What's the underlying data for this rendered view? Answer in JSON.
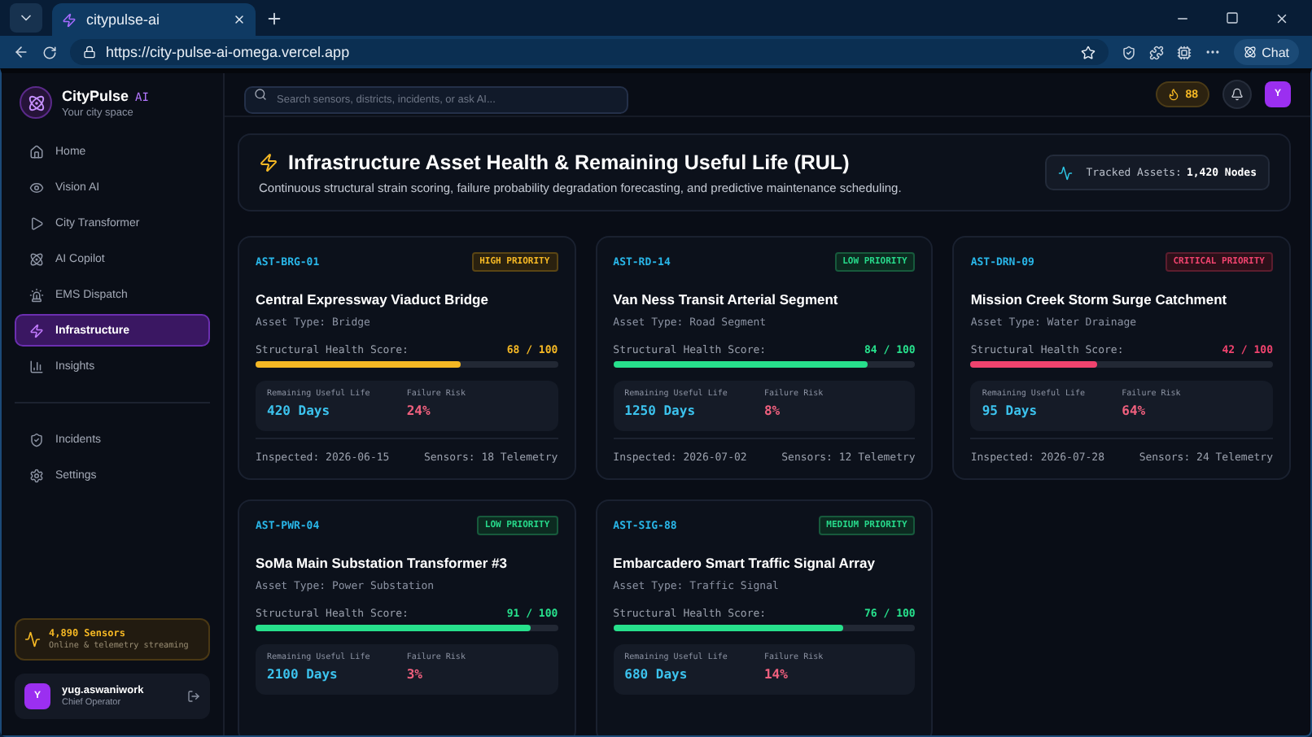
{
  "browser": {
    "tab_title": "citypulse-ai",
    "url": "https://city-pulse-ai-omega.vercel.app",
    "chat_label": "Chat"
  },
  "brand": {
    "name": "CityPulse",
    "badge": "AI",
    "tagline": "Your city space"
  },
  "nav": [
    {
      "label": "Home",
      "selected": false
    },
    {
      "label": "Vision AI",
      "selected": false
    },
    {
      "label": "City Transformer",
      "selected": false
    },
    {
      "label": "AI Copilot",
      "selected": false
    },
    {
      "label": "EMS Dispatch",
      "selected": false
    },
    {
      "label": "Infrastructure",
      "selected": true
    },
    {
      "label": "Insights",
      "selected": false
    }
  ],
  "nav_secondary": [
    {
      "label": "Incidents",
      "selected": false
    },
    {
      "label": "Settings",
      "selected": false
    }
  ],
  "sensors": {
    "count": "4,890 Sensors",
    "status": "Online & telemetry streaming"
  },
  "user": {
    "initial": "Y",
    "name": "yug.aswaniwork",
    "role": "Chief Operator"
  },
  "topbar": {
    "search_placeholder": "Search sensors, districts, incidents, or ask AI...",
    "streak": "88",
    "avatar": "Y"
  },
  "header": {
    "title": "Infrastructure Asset Health & Remaining Useful Life (RUL)",
    "subtitle": "Continuous structural strain scoring, failure probability degradation forecasting, and predictive maintenance scheduling.",
    "tracked_label": "Tracked Assets:",
    "tracked_value": "1,420 Nodes"
  },
  "assets": [
    {
      "id": "AST-BRG-01",
      "badge": {
        "kind": "high",
        "label": "HIGH PRIORITY"
      },
      "name": "Central Expressway Viaduct Bridge",
      "type": "Asset Type: Bridge",
      "score_label": "Structural Health Score:",
      "score": {
        "kind": "fair",
        "value": "68 / 100",
        "level": 0.68
      },
      "rul_label": "Remaining Useful Life",
      "rul": "420 Days",
      "risk_label": "Failure Risk",
      "risk": "24%",
      "inspected": "Inspected: 2026-06-15",
      "sensors": "Sensors: 18 Telemetry"
    },
    {
      "id": "AST-RD-14",
      "badge": {
        "kind": "low",
        "label": "LOW PRIORITY"
      },
      "name": "Van Ness Transit Arterial Segment",
      "type": "Asset Type: Road Segment",
      "score_label": "Structural Health Score:",
      "score": {
        "kind": "good",
        "value": "84 / 100",
        "level": 0.84
      },
      "rul_label": "Remaining Useful Life",
      "rul": "1250 Days",
      "risk_label": "Failure Risk",
      "risk": "8%",
      "inspected": "Inspected: 2026-07-02",
      "sensors": "Sensors: 12 Telemetry"
    },
    {
      "id": "AST-DRN-09",
      "badge": {
        "kind": "critical",
        "label": "CRITICAL PRIORITY"
      },
      "name": "Mission Creek Storm Surge Catchment",
      "type": "Asset Type: Water Drainage",
      "score_label": "Structural Health Score:",
      "score": {
        "kind": "poor",
        "value": "42 / 100",
        "level": 0.42
      },
      "rul_label": "Remaining Useful Life",
      "rul": "95 Days",
      "risk_label": "Failure Risk",
      "risk": "64%",
      "inspected": "Inspected: 2026-07-28",
      "sensors": "Sensors: 24 Telemetry"
    },
    {
      "id": "AST-PWR-04",
      "badge": {
        "kind": "low",
        "label": "LOW PRIORITY"
      },
      "name": "SoMa Main Substation Transformer #3",
      "type": "Asset Type: Power Substation",
      "score_label": "Structural Health Score:",
      "score": {
        "kind": "good",
        "value": "91 / 100",
        "level": 0.91
      },
      "rul_label": "Remaining Useful Life",
      "rul": "2100 Days",
      "risk_label": "Failure Risk",
      "risk": "3%"
    },
    {
      "id": "AST-SIG-88",
      "badge": {
        "kind": "medium",
        "label": "MEDIUM PRIORITY"
      },
      "name": "Embarcadero Smart Traffic Signal Array",
      "type": "Asset Type: Traffic Signal",
      "score_label": "Structural Health Score:",
      "score": {
        "kind": "good",
        "value": "76 / 100",
        "level": 0.76
      },
      "rul_label": "Remaining Useful Life",
      "rul": "680 Days",
      "risk_label": "Failure Risk",
      "risk": "14%"
    }
  ]
}
